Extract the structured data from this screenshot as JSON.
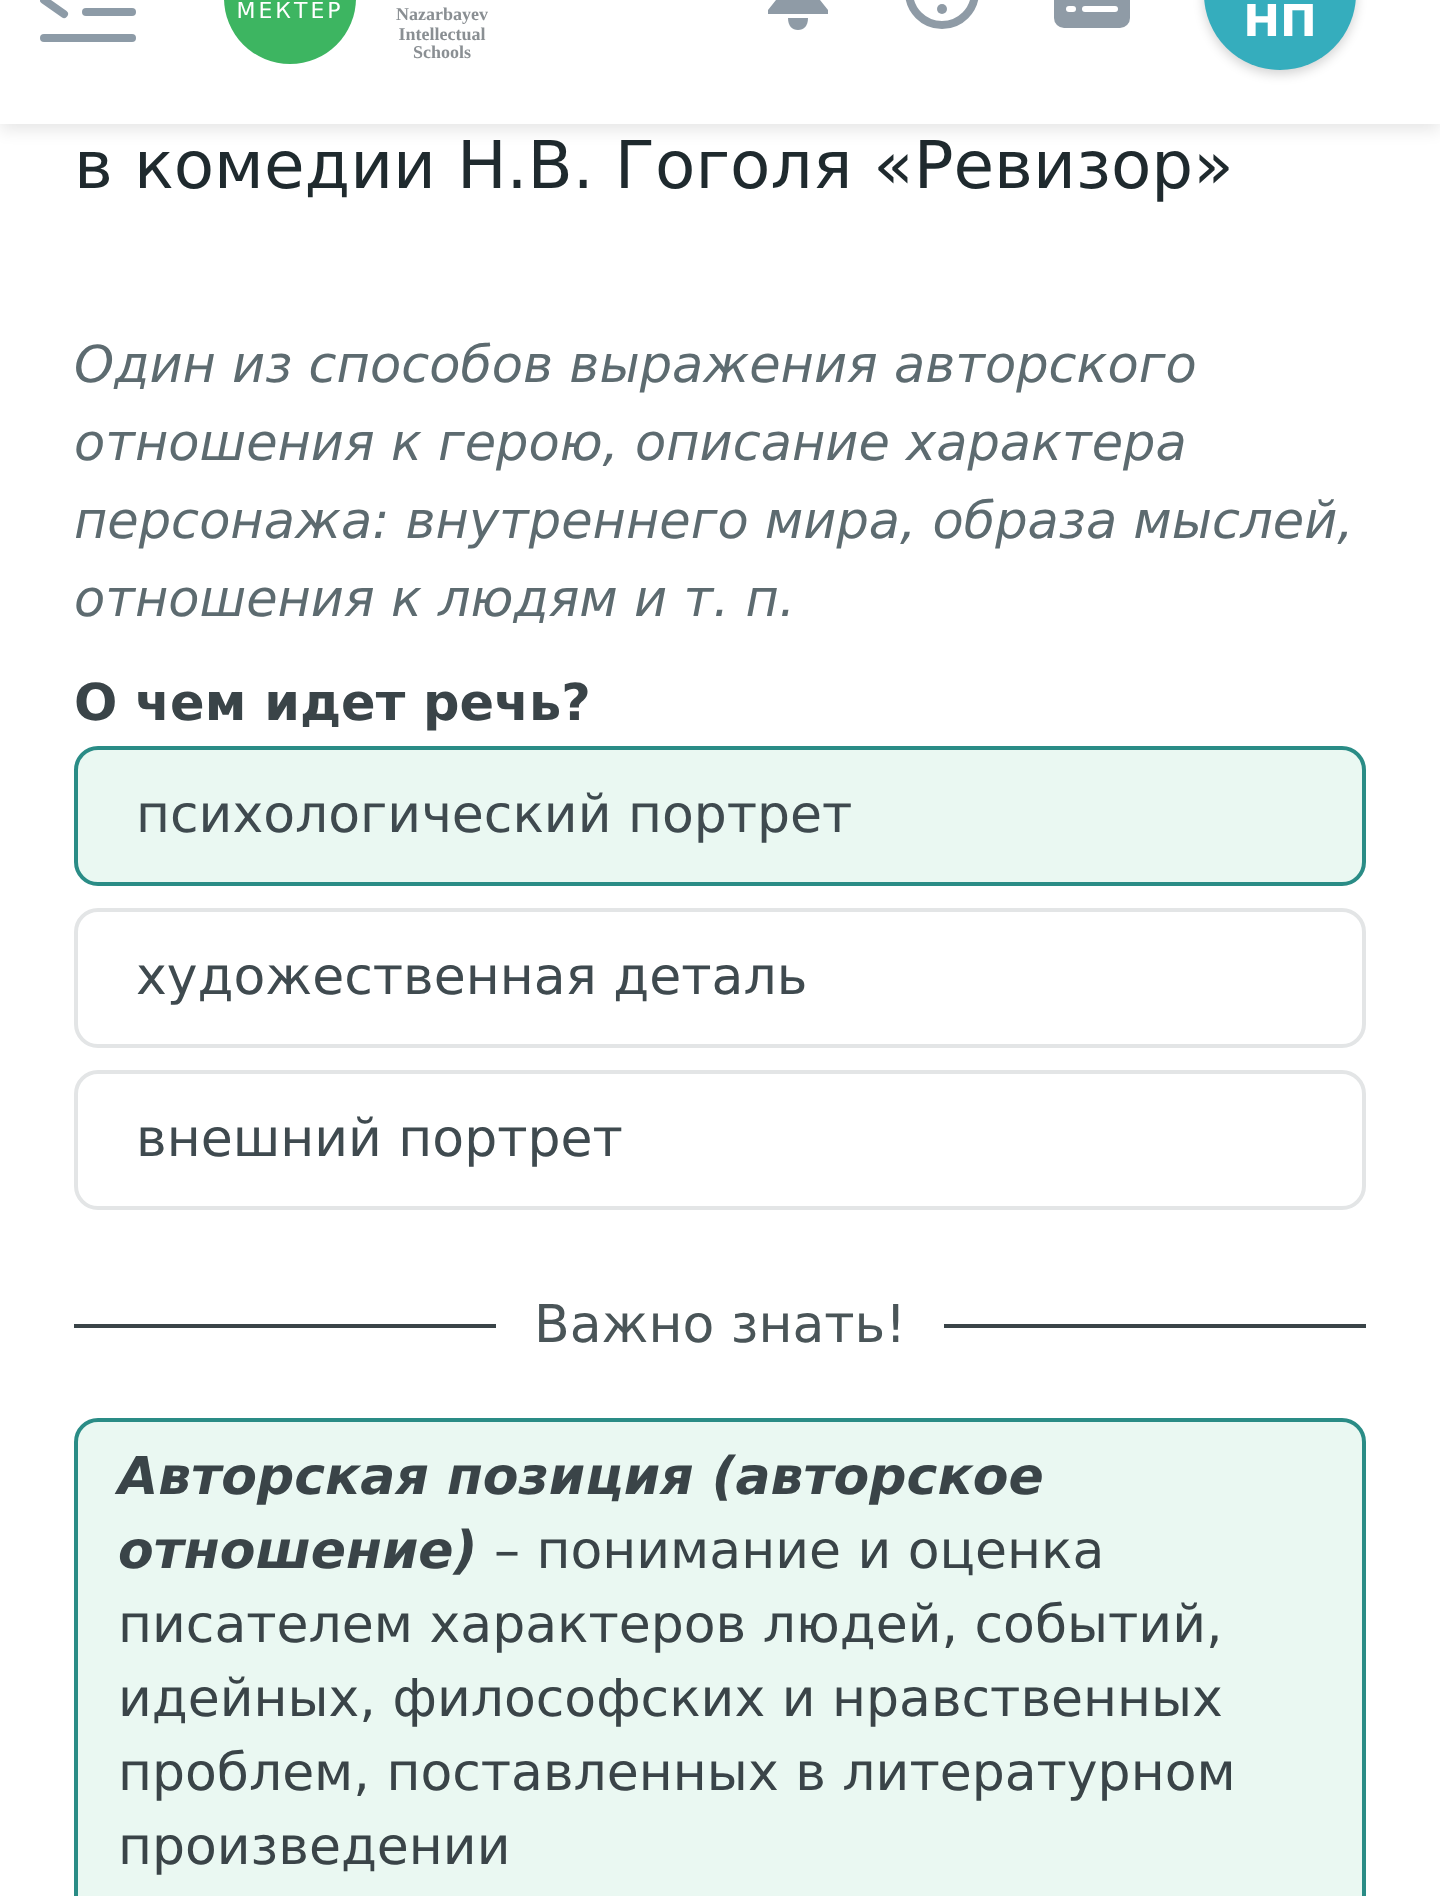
{
  "header": {
    "logo_text": "МЕКТЕР",
    "school_name": "Nazarbayev Intellectual Schools",
    "avatar_initials": "НП"
  },
  "lesson_title": "в комедии Н.В. Гоголя «Ревизор»",
  "task": {
    "description": "Один из способов выражения авторского отношения к герою, описание характера персонажа: внутреннего мира, образа мыслей, отношения к людям и т. п.",
    "question": "О чем идет речь?",
    "options": [
      {
        "label": "психологический портрет",
        "selected": true
      },
      {
        "label": "художественная деталь",
        "selected": false
      },
      {
        "label": "внешний портрет",
        "selected": false
      }
    ]
  },
  "important": {
    "heading": "Важно знать!",
    "text": "**Авторская позиция (авторское отношение)** – понимание и оценка писателем характеров людей, событий, идейных, философских и нравственных проблем, поставленных в литературном произведении"
  }
}
